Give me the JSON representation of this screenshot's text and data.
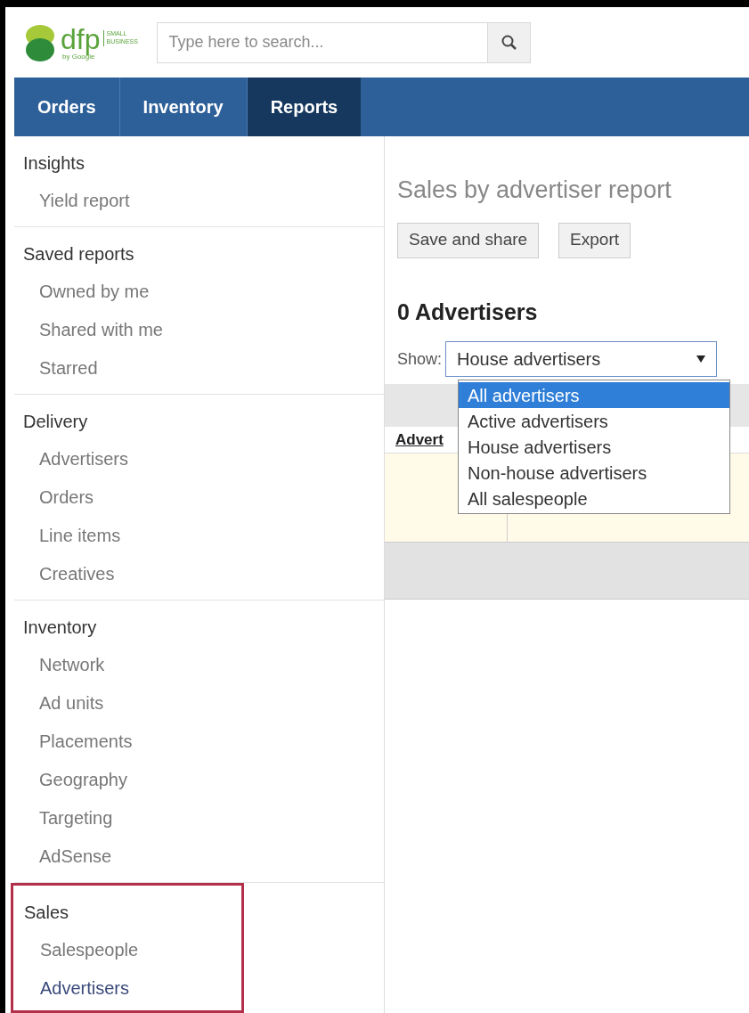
{
  "logo": {
    "wordmark": "dfp",
    "tagline": "SMALL BUSINESS",
    "byline": "by Google"
  },
  "search": {
    "placeholder": "Type here to search..."
  },
  "tabs": [
    {
      "label": "Orders",
      "selected": false
    },
    {
      "label": "Inventory",
      "selected": false
    },
    {
      "label": "Reports",
      "selected": true
    }
  ],
  "sidebar": {
    "sections": [
      {
        "title": "Insights",
        "highlighted": false,
        "items": [
          {
            "label": "Yield report",
            "selected": false
          }
        ]
      },
      {
        "title": "Saved reports",
        "highlighted": false,
        "items": [
          {
            "label": "Owned by me",
            "selected": false
          },
          {
            "label": "Shared with me",
            "selected": false
          },
          {
            "label": "Starred",
            "selected": false
          }
        ]
      },
      {
        "title": "Delivery",
        "highlighted": false,
        "items": [
          {
            "label": "Advertisers",
            "selected": false
          },
          {
            "label": "Orders",
            "selected": false
          },
          {
            "label": "Line items",
            "selected": false
          },
          {
            "label": "Creatives",
            "selected": false
          }
        ]
      },
      {
        "title": "Inventory",
        "highlighted": false,
        "items": [
          {
            "label": "Network",
            "selected": false
          },
          {
            "label": "Ad units",
            "selected": false
          },
          {
            "label": "Placements",
            "selected": false
          },
          {
            "label": "Geography",
            "selected": false
          },
          {
            "label": "Targeting",
            "selected": false
          },
          {
            "label": "AdSense",
            "selected": false
          }
        ]
      },
      {
        "title": "Sales",
        "highlighted": true,
        "items": [
          {
            "label": "Salespeople",
            "selected": false
          },
          {
            "label": "Advertisers",
            "selected": true
          }
        ]
      }
    ]
  },
  "report": {
    "title": "Sales by advertiser report",
    "buttons": [
      "Save and share",
      "Export"
    ],
    "count": "0 Advertisers",
    "show_label": "Show:",
    "show_select": {
      "value": "House advertisers",
      "expanded": true,
      "options": [
        {
          "label": "All advertisers",
          "highlighted": true
        },
        {
          "label": "Active advertisers",
          "highlighted": false
        },
        {
          "label": "House advertisers",
          "highlighted": false
        },
        {
          "label": "Non-house advertisers",
          "highlighted": false
        },
        {
          "label": "All salespeople",
          "highlighted": false
        }
      ]
    },
    "table": {
      "columns": [
        "Advert"
      ]
    }
  }
}
